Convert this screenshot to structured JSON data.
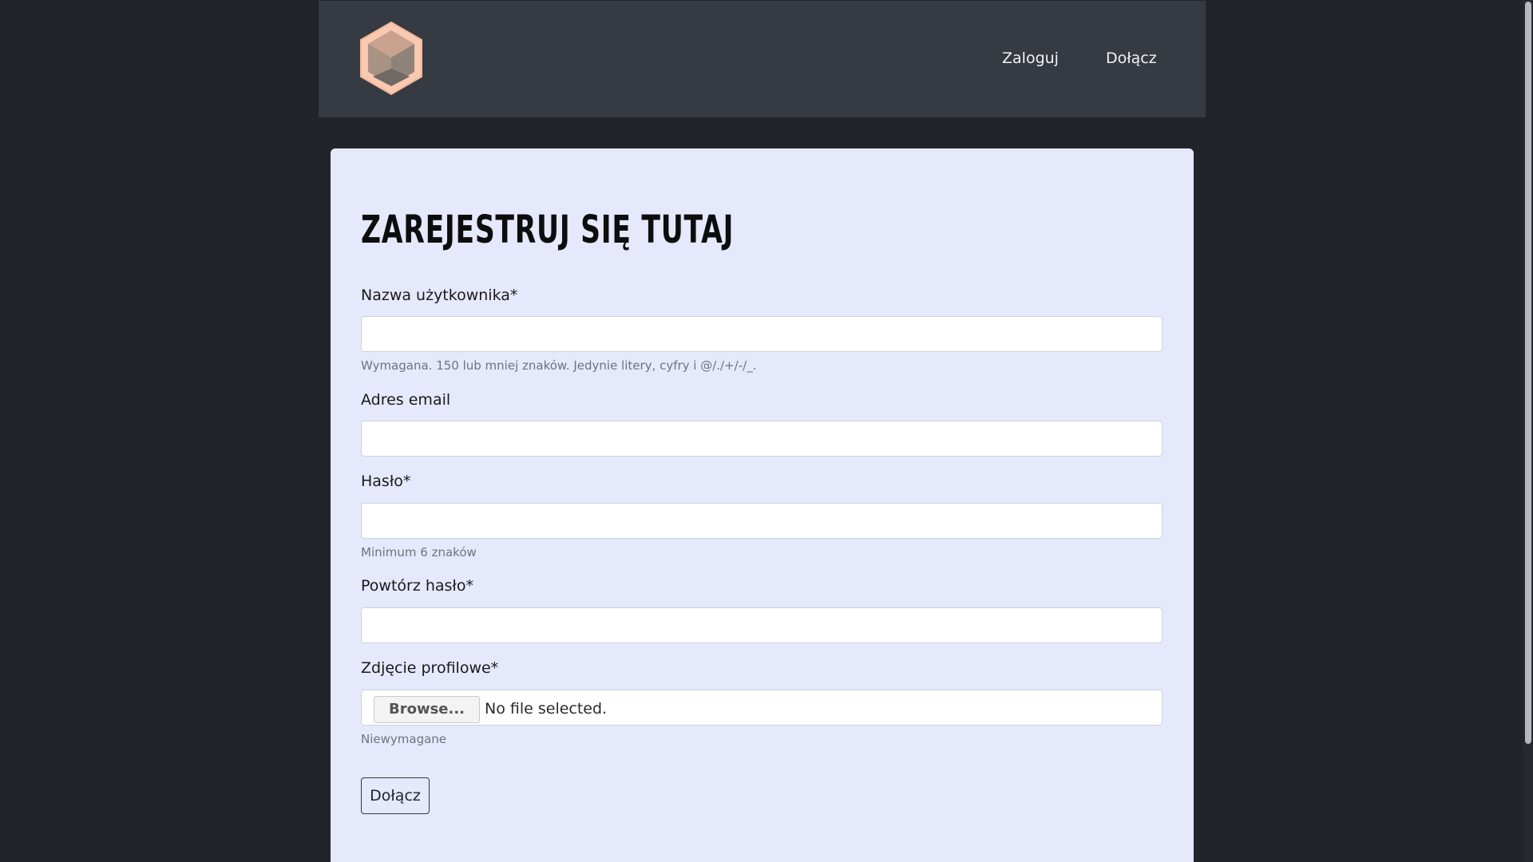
{
  "nav": {
    "logo_icon": "hexagon-cube-logo",
    "login_label": "Zaloguj",
    "join_label": "Dołącz"
  },
  "form": {
    "title": "ZAREJESTRUJ SIĘ TUTAJ",
    "username": {
      "label": "Nazwa użytkownika*",
      "value": "",
      "help": "Wymagana. 150 lub mniej znaków. Jedynie litery, cyfry i @/./+/-/_."
    },
    "email": {
      "label": "Adres email",
      "value": ""
    },
    "password": {
      "label": "Hasło*",
      "value": "",
      "help": "Minimum 6 znaków"
    },
    "password_repeat": {
      "label": "Powtórz hasło*",
      "value": ""
    },
    "avatar": {
      "label": "Zdjęcie profilowe*",
      "browse_label": "Browse...",
      "status": "No file selected.",
      "help": "Niewymagane"
    },
    "submit_label": "Dołącz"
  },
  "colors": {
    "page_background": "#212429",
    "navbar_background": "#363a42",
    "card_background": "#e6e8fc",
    "logo_fill": "#f9c9b1"
  }
}
